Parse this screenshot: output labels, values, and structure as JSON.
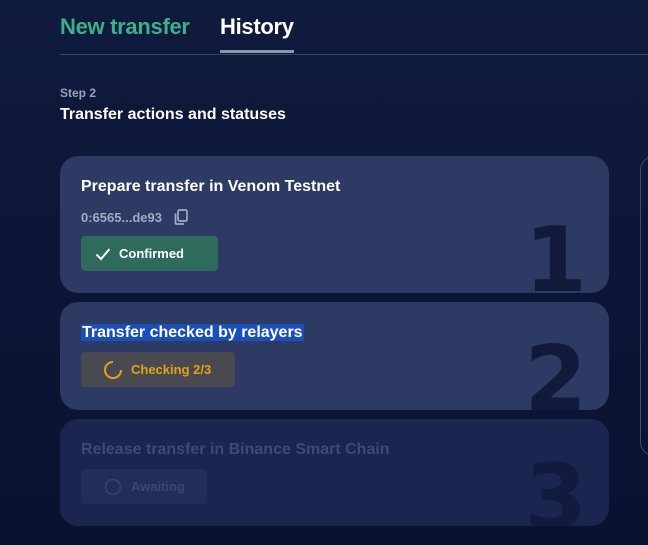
{
  "tabs": [
    {
      "label": "New transfer",
      "active": false
    },
    {
      "label": "History",
      "active": true
    }
  ],
  "step": {
    "label": "Step 2",
    "title": "Transfer actions and statuses"
  },
  "cards": [
    {
      "title": "Prepare transfer in Venom Testnet",
      "address": "0:6565...de93",
      "status": "Confirmed",
      "number": "1"
    },
    {
      "title": "Transfer checked by relayers",
      "status": "Checking 2/3",
      "number": "2"
    },
    {
      "title": "Release transfer in Binance Smart Chain",
      "status": "Awaiting",
      "number": "3"
    }
  ],
  "colors": {
    "background": "#0d1637",
    "card": "#2c3a64",
    "card_disabled": "#1a2550",
    "accent_green": "#3cb08a",
    "confirmed_bg": "#2e6b5c",
    "checking_text": "#e3a21a",
    "highlight": "#1a4fb8"
  },
  "icons": {
    "copy": "copy-icon",
    "check": "check-icon",
    "spinner": "spinner-icon"
  }
}
